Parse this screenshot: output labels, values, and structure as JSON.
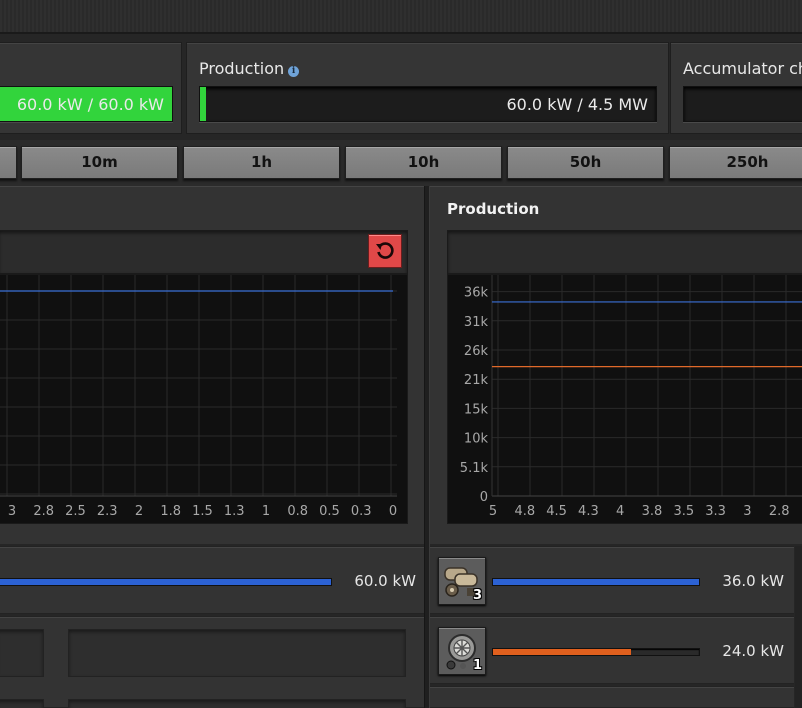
{
  "satisfaction": {
    "value_text": "60.0 kW / 60.0 kW",
    "fill_fraction": 1.0,
    "color": "#32d43c"
  },
  "production": {
    "title": "Production",
    "info_icon": "info-icon",
    "value_text": "60.0 kW / 4.5 MW",
    "fill_fraction": 0.013,
    "color": "#32d43c"
  },
  "accumulator": {
    "title": "Accumulator cha"
  },
  "time_buttons": [
    "10m",
    "1h",
    "10h",
    "50h",
    "250h"
  ],
  "consumption_graph": {
    "reset_icon": "reset-icon",
    "x_ticks": [
      "3",
      "2.8",
      "2.5",
      "2.3",
      "2",
      "1.8",
      "1.5",
      "1.3",
      "1",
      "0.8",
      "0.5",
      "0.3",
      "0"
    ]
  },
  "production_graph": {
    "title": "Production",
    "y_ticks": [
      "36k",
      "31k",
      "26k",
      "21k",
      "15k",
      "10k",
      "5.1k",
      "0"
    ],
    "x_ticks": [
      "5",
      "4.8",
      "4.5",
      "4.3",
      "4",
      "3.8",
      "3.5",
      "3.3",
      "3",
      "2.8"
    ]
  },
  "chart_data": [
    {
      "type": "line",
      "title": "",
      "x_ticks": [
        "3",
        "2.8",
        "2.5",
        "2.3",
        "2",
        "1.8",
        "1.5",
        "1.3",
        "1",
        "0.8",
        "0.5",
        "0.3",
        "0"
      ],
      "series": [
        {
          "color": "#3b6fd6",
          "values": [
            60000,
            60000
          ]
        }
      ]
    },
    {
      "type": "line",
      "title": "Production",
      "ylim": [
        0,
        41000
      ],
      "y_ticks": [
        "36k",
        "31k",
        "26k",
        "21k",
        "15k",
        "10k",
        "5.1k",
        "0"
      ],
      "x_ticks": [
        "5",
        "4.8",
        "4.5",
        "4.3",
        "4",
        "3.8",
        "3.5",
        "3.3",
        "3",
        "2.8"
      ],
      "series": [
        {
          "color": "#3b6fd6",
          "values": [
            36000,
            36000
          ]
        },
        {
          "color": "#e0692a",
          "values": [
            24000,
            24000
          ]
        }
      ]
    }
  ],
  "consumers": [
    {
      "value_text": "60.0 kW",
      "fill_fraction": 1.0,
      "color": "#2c62d4"
    }
  ],
  "producers": [
    {
      "icon": "steam-engine-icon",
      "count": "3",
      "value_text": "36.0 kW",
      "fill_fraction": 1.0,
      "color": "#2c62d4"
    },
    {
      "icon": "steam-turbine-icon",
      "count": "1",
      "value_text": "24.0 kW",
      "fill_fraction": 0.67,
      "color": "#e0601e"
    }
  ]
}
